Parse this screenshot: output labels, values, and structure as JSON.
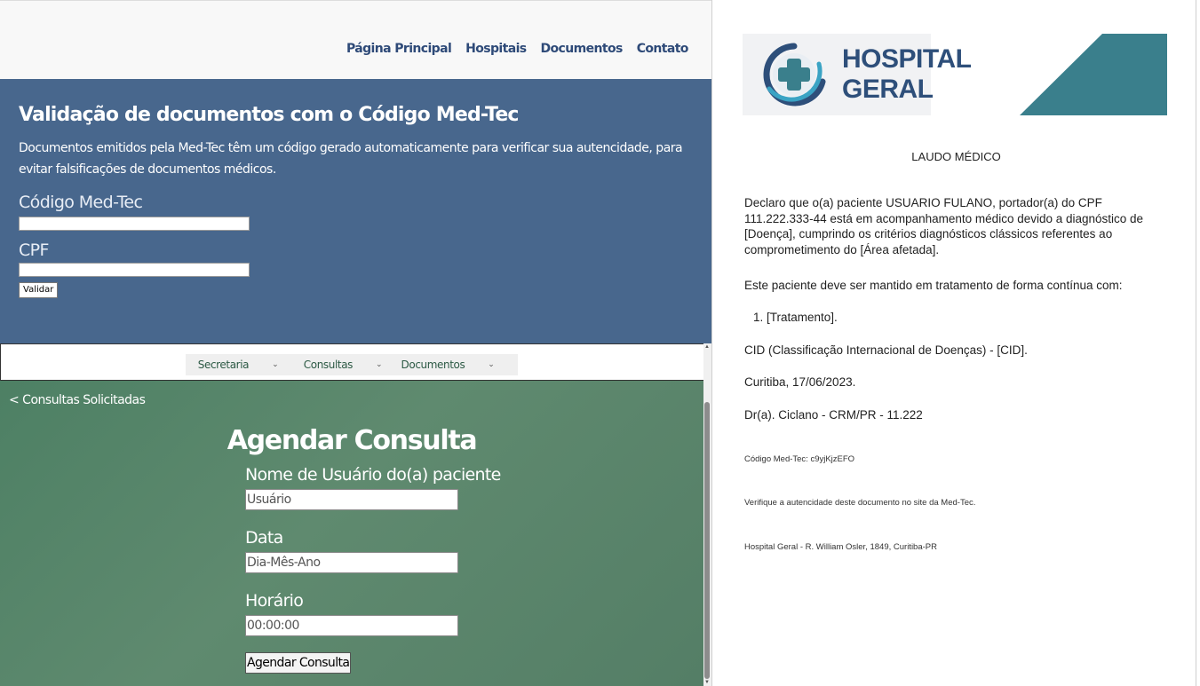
{
  "nav": {
    "links": [
      "Página Principal",
      "Hospitais",
      "Documentos",
      "Contato"
    ]
  },
  "validate": {
    "title": "Validação de documentos com o Código Med-Tec",
    "description": "Documentos emitidos pela Med-Tec têm um código gerado automaticamente para verificar sua autencidade, para evitar falsificações de documentos médicos.",
    "code_label": "Código Med-Tec",
    "cpf_label": "CPF",
    "button_label": "Validar"
  },
  "subnav": {
    "items": [
      "Secretaria",
      "Consultas",
      "Documentos"
    ],
    "chevron": "⌄"
  },
  "schedule": {
    "back_label": "< Consultas Solicitadas",
    "title": "Agendar Consulta",
    "user_label": "Nome de Usuário do(a) paciente",
    "user_placeholder": "Usuário",
    "date_label": "Data",
    "date_placeholder": "Dia-Mês-Ano",
    "time_label": "Horário",
    "time_placeholder": "00:00:00",
    "button_label": "Agendar Consulta"
  },
  "document": {
    "logo_line1": "HOSPITAL",
    "logo_line2": "GERAL",
    "title": "LAUDO MÉDICO",
    "declaration": "Declaro que o(a) paciente USUARIO FULANO, portador(a) do CPF 111.222.333-44 está em acompanhamento médico devido a diagnóstico de [Doença], cumprindo os critérios diagnósticos clássicos referentes ao comprometimento do [Área afetada].",
    "treatment_intro": "Este paciente deve ser mantido em tratamento de forma contínua com:",
    "treatment_item": "1. [Tratamento].",
    "cid": "CID (Classificação Internacional de Doenças) - [CID].",
    "place_date": "Curitiba, 17/06/2023.",
    "doctor": "Dr(a). Ciclano - CRM/PR - 11.222",
    "code": "Código Med-Tec: c9yjKjzEFO",
    "verify": "Verifique a autencidade deste documento no site da Med-Tec.",
    "address": "Hospital Geral - R. William Osler, 1849, Curitiba-PR"
  },
  "colors": {
    "validate_bg": "#48678d",
    "schedule_bg": "#5a8a6c",
    "logo_teal": "#3a7f8c",
    "logo_navy": "#2e4f7a"
  }
}
